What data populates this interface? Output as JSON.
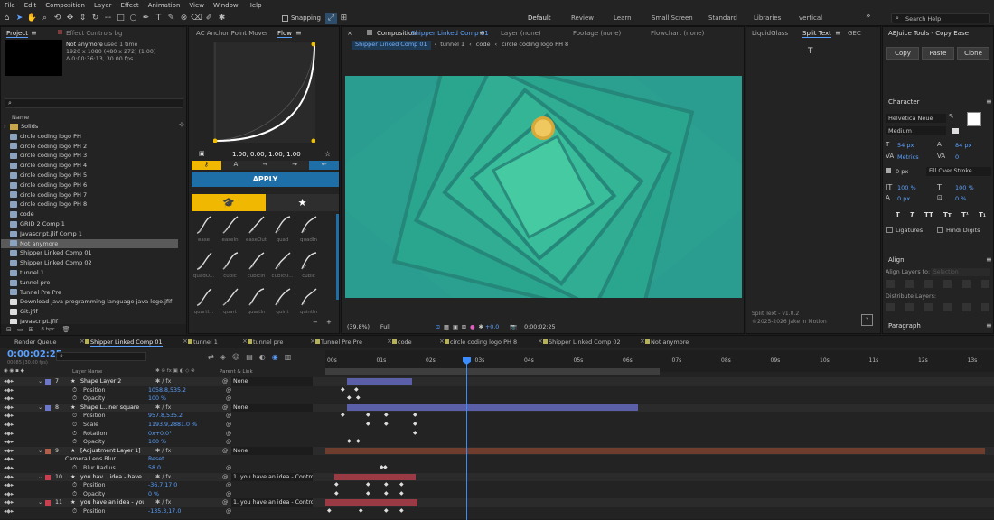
{
  "menubar": [
    "File",
    "Edit",
    "Composition",
    "Layer",
    "Effect",
    "Animation",
    "View",
    "Window",
    "Help"
  ],
  "toolbar": {
    "snapping": "Snapping",
    "workspaces": [
      "Default",
      "Review",
      "Learn",
      "Small Screen",
      "Standard",
      "Libraries",
      "vertical"
    ],
    "search": "Search Help"
  },
  "project": {
    "tab_project": "Project",
    "tab_effect": "Effect Controls bg",
    "info_name": "Not anymore",
    "info_used": ", used 1 time",
    "info_dims": "1920 x 1080 (480 x 272) (1.00)",
    "info_dur": "Δ 0:00:36:13, 30.00 fps",
    "col_name": "Name",
    "items": [
      "Solids",
      "circle coding logo PH",
      "circle coding logo PH 2",
      "circle coding logo PH 3",
      "circle coding logo PH 4",
      "circle coding logo PH 5",
      "circle coding logo PH 6",
      "circle coding logo PH 7",
      "circle coding logo PH 8",
      "code",
      "GRID 2 Comp 1",
      "Javascript.jlif Comp 1",
      "Not anymore",
      "Shipper Linked Comp 01",
      "Shipper Linked Comp 02",
      "tunnel 1",
      "tunnel pre",
      "Tunnel Pre Pre",
      "Download java programming language java logo.jfif",
      "Git.jfif",
      "Javascript.jfif"
    ],
    "bpc": "8 bpc"
  },
  "flow": {
    "tab_ac": "AC Anchor Point Mover",
    "tab_flow": "Flow",
    "curve_values": "1.00, 0.00, 1.00, 1.00",
    "apply": "APPLY",
    "ease_names": [
      "ease",
      "easeIn",
      "easeOut",
      "quad",
      "quadIn",
      "quadO...",
      "cubic",
      "cubicIn",
      "cubicO...",
      "cubic",
      "quartI...",
      "quart",
      "quartIn",
      "quint",
      "quintIn"
    ]
  },
  "comp": {
    "tab_comp": "Composition",
    "comp_name": "Shipper Linked Comp 01",
    "tab_layer": "Layer  (none)",
    "tab_footage": "Footage  (none)",
    "tab_flowchart": "Flowchart  (none)",
    "crumbs": [
      "Shipper Linked Comp 01",
      "tunnel 1",
      "code",
      "circle coding logo PH 8"
    ],
    "zoom": "(39.8%)",
    "res": "Full",
    "exposure": "+0.0",
    "timecode": "0:00:02:25",
    "colors": {
      "bg1": "#2a9d8f",
      "bg2": "#3fbf9a",
      "ball": "#f0c44a"
    }
  },
  "split": {
    "tab_liquid": "LiquidGlass",
    "tab_split": "Split Text",
    "tab_gec": "GEC",
    "version": "Split Text - v1.0.2",
    "copyright": "©2025-2026 Jake In Motion",
    "help": "?"
  },
  "aejuice": {
    "title": "AEJuice Tools - Copy Ease",
    "copy": "Copy",
    "paste": "Paste",
    "clone": "Clone"
  },
  "character": {
    "title": "Character",
    "font": "Helvetica Neue",
    "style": "Medium",
    "size": "54 px",
    "leading": "84 px",
    "kern": "Metrics",
    "track": "0",
    "stroke": "0 px",
    "stroke_mode": "Fill Over Stroke",
    "vscale": "100 %",
    "hscale": "100 %",
    "baseline": "0 px",
    "tsume": "0 %",
    "styles": [
      "T",
      "T",
      "TT",
      "Tт",
      "T¹",
      "T₁"
    ],
    "ligatures": "Ligatures",
    "hindi": "Hindi Digits"
  },
  "align": {
    "title": "Align",
    "align_to": "Align Layers to:",
    "selection": "Selection",
    "distribute": "Distribute Layers:"
  },
  "paragraph": {
    "title": "Paragraph"
  },
  "timeline": {
    "tabs": [
      "Render Queue",
      "Shipper Linked Comp 01",
      "tunnel 1",
      "tunnel pre",
      "Tunnel Pre Pre",
      "code",
      "circle coding logo PH 8",
      "Shipper Linked Comp 02",
      "Not anymore"
    ],
    "timecode": "0:00:02:25",
    "frames": "00085 (30.00 fps)",
    "col_layer": "Layer Name",
    "col_parent": "Parent & Link",
    "ruler": [
      "00s",
      "01s",
      "02s",
      "03s",
      "04s",
      "05s",
      "06s",
      "07s",
      "08s",
      "09s",
      "10s",
      "11s",
      "12s",
      "13s"
    ],
    "rows": [
      {
        "num": "7",
        "name": "Shape Layer 2",
        "parent": "None",
        "kind": "layer",
        "color": "#6e78c8"
      },
      {
        "name": "Position",
        "value": "1058.8,535.2",
        "kind": "prop"
      },
      {
        "name": "Opacity",
        "value": "100 %",
        "kind": "prop"
      },
      {
        "num": "8",
        "name": "Shape L...ner square",
        "parent": "None",
        "kind": "layer",
        "color": "#6e78c8"
      },
      {
        "name": "Position",
        "value": "957.8,535.2",
        "kind": "prop"
      },
      {
        "name": "Scale",
        "value": "1193.9,2881.0 %",
        "kind": "prop"
      },
      {
        "name": "Rotation",
        "value": "0x+0.0°",
        "kind": "prop"
      },
      {
        "name": "Opacity",
        "value": "100 %",
        "kind": "prop"
      },
      {
        "num": "9",
        "name": "[Adjustment Layer 1]",
        "parent": "None",
        "kind": "layer",
        "color": "#b0604a"
      },
      {
        "name": "Camera Lens Blur",
        "value": "Reset",
        "kind": "effect"
      },
      {
        "name": "Blur Radius",
        "value": "58.0",
        "kind": "prop"
      },
      {
        "num": "10",
        "name": "you hav... idea - have",
        "parent": "1. you have an idea - Control",
        "kind": "layer",
        "color": "#c84050"
      },
      {
        "name": "Position",
        "value": "-36.7,17.0",
        "kind": "prop"
      },
      {
        "name": "Opacity",
        "value": "0 %",
        "kind": "prop"
      },
      {
        "num": "11",
        "name": "you have an idea - you",
        "parent": "1. you have an idea - Control",
        "kind": "layer",
        "color": "#c84050"
      },
      {
        "name": "Position",
        "value": "-135.3,17.0",
        "kind": "prop"
      }
    ]
  }
}
